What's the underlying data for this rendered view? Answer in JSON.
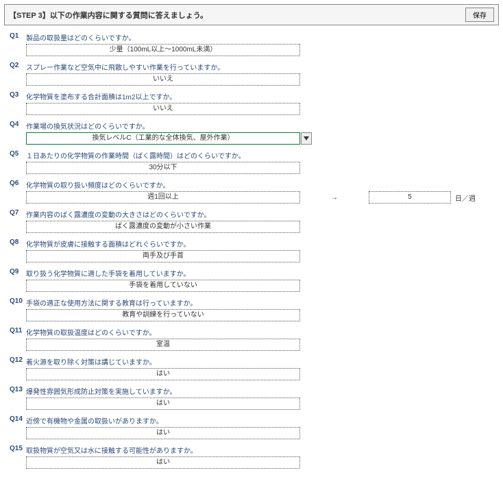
{
  "header": {
    "title": "【STEP 3】以下の作業内容に関する質問に答えましょう。",
    "save_label": "保存"
  },
  "questions": [
    {
      "num": "Q1",
      "text": "製品の取扱量はどのくらいですか。",
      "answer": "少量（100mL以上～1000mL未満）"
    },
    {
      "num": "Q2",
      "text": "スプレー作業など空気中に飛散しやすい作業を行っていますか。",
      "answer": "いいえ"
    },
    {
      "num": "Q3",
      "text": "化学物質を塗布する合計面積は1m2以上ですか。",
      "answer": "いいえ"
    },
    {
      "num": "Q4",
      "text": "作業場の換気状況はどのくらいですか。",
      "answer": "換気レベルC（工業的な全体換気、屋外作業）",
      "focused": true
    },
    {
      "num": "Q5",
      "text": "１日あたりの化学物質の作業時間（ばく露時間）はどのくらいですか。",
      "answer": "30分以下"
    },
    {
      "num": "Q6",
      "text": "化学物質の取り扱い頻度はどのくらいですか。",
      "answer": "週1回以上",
      "arrow": "→",
      "value": "5",
      "unit": "日／週"
    },
    {
      "num": "Q7",
      "text": "作業内容のばく露濃度の変動の大きさはどのくらいですか。",
      "answer": "ばく露濃度の変動が小さい作業"
    },
    {
      "num": "Q8",
      "text": "化学物質が皮膚に接触する面積はどれぐらいですか。",
      "answer": "両手及び手首"
    },
    {
      "num": "Q9",
      "text": "取り扱う化学物質に適した手袋を着用していますか。",
      "answer": "手袋を着用していない"
    },
    {
      "num": "Q10",
      "text": "手袋の適正な使用方法に関する教育は行っていますか。",
      "answer": "教育や訓練を行っていない"
    },
    {
      "num": "Q11",
      "text": "化学物質の取扱温度はどのくらいですか。",
      "answer": "室温"
    },
    {
      "num": "Q12",
      "text": "着火源を取り除く対策は講じていますか。",
      "answer": "はい"
    },
    {
      "num": "Q13",
      "text": "爆発性雰囲気形成防止対策を実施していますか。",
      "answer": "はい"
    },
    {
      "num": "Q14",
      "text": "近傍で有機物や金属の取扱いがありますか。",
      "answer": "はい"
    },
    {
      "num": "Q15",
      "text": "取扱物質が空気又は水に接触する可能性がありますか。",
      "answer": "はい"
    }
  ]
}
